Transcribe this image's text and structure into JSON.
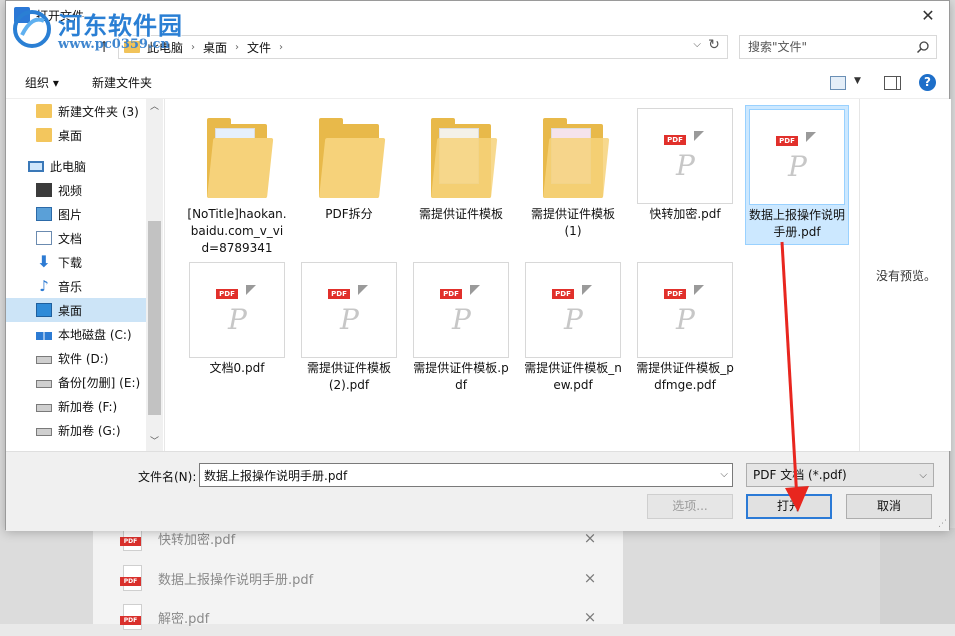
{
  "background": {
    "recent_files": [
      {
        "name": "快转加密.pdf",
        "remove": "×"
      },
      {
        "name": "数据上报操作说明手册.pdf",
        "remove": "×"
      },
      {
        "name": "解密.pdf",
        "remove": "×"
      }
    ],
    "pdf_tag": "PDF"
  },
  "watermark": {
    "main": "河东软件园",
    "url": "www.pc0359.cn"
  },
  "dialog": {
    "title": "打开文件",
    "close": "✕",
    "nav": {
      "up": "↑",
      "breadcrumbs": [
        "此电脑",
        "桌面",
        "文件"
      ],
      "separator": "›",
      "dropdown": "⌵",
      "refresh": "↻"
    },
    "search": {
      "placeholder": "搜索\"文件\""
    },
    "toolbar": {
      "organize": "组织 ▾",
      "new_folder": "新建文件夹",
      "help": "?"
    },
    "sidebar": {
      "items": [
        {
          "label": "新建文件夹 (3)",
          "icon": "folder-icon"
        },
        {
          "label": "桌面",
          "icon": "folder-icon"
        },
        {
          "label": "此电脑",
          "icon": "pc-icon"
        },
        {
          "label": "视频",
          "icon": "video-icon"
        },
        {
          "label": "图片",
          "icon": "image-icon"
        },
        {
          "label": "文档",
          "icon": "document-icon"
        },
        {
          "label": "下载",
          "icon": "download-icon"
        },
        {
          "label": "音乐",
          "icon": "music-icon"
        },
        {
          "label": "桌面",
          "icon": "desktop-icon",
          "selected": true
        },
        {
          "label": "本地磁盘 (C:)",
          "icon": "system-drive-icon"
        },
        {
          "label": "软件 (D:)",
          "icon": "drive-icon"
        },
        {
          "label": "备份[勿删] (E:)",
          "icon": "drive-icon"
        },
        {
          "label": "新加卷 (F:)",
          "icon": "drive-icon"
        },
        {
          "label": "新加卷 (G:)",
          "icon": "drive-icon"
        }
      ],
      "scroll_up": "︿",
      "scroll_down": "﹀"
    },
    "files": [
      {
        "label": "[NoTitle]haokan.baidu.com_v_vid=8789341",
        "type": "folder"
      },
      {
        "label": "PDF拆分",
        "type": "folder"
      },
      {
        "label": "需提供证件模板",
        "type": "folder"
      },
      {
        "label": "需提供证件模板(1)",
        "type": "folder"
      },
      {
        "label": "快转加密.pdf",
        "type": "pdf"
      },
      {
        "label": "数据上报操作说明手册.pdf",
        "type": "pdf",
        "selected": true
      },
      {
        "label": "文档0.pdf",
        "type": "pdf"
      },
      {
        "label": "需提供证件模板(2).pdf",
        "type": "pdf"
      },
      {
        "label": "需提供证件模板.pdf",
        "type": "pdf"
      },
      {
        "label": "需提供证件模板_new.pdf",
        "type": "pdf"
      },
      {
        "label": "需提供证件模板_pdfmge.pdf",
        "type": "pdf"
      }
    ],
    "preview": {
      "message": "没有预览。"
    },
    "bottom": {
      "filename_label": "文件名(N):",
      "filename_value": "数据上报操作说明手册.pdf",
      "filetype": "PDF 文档 (*.pdf)",
      "dropdown": "⌵",
      "options": "选项...",
      "open": "打开",
      "cancel": "取消"
    }
  },
  "colors": {
    "accent": "#2b7ad6",
    "selection": "#cce8ff",
    "annotation": "#e8261f",
    "pdf_red": "#e1302b"
  }
}
